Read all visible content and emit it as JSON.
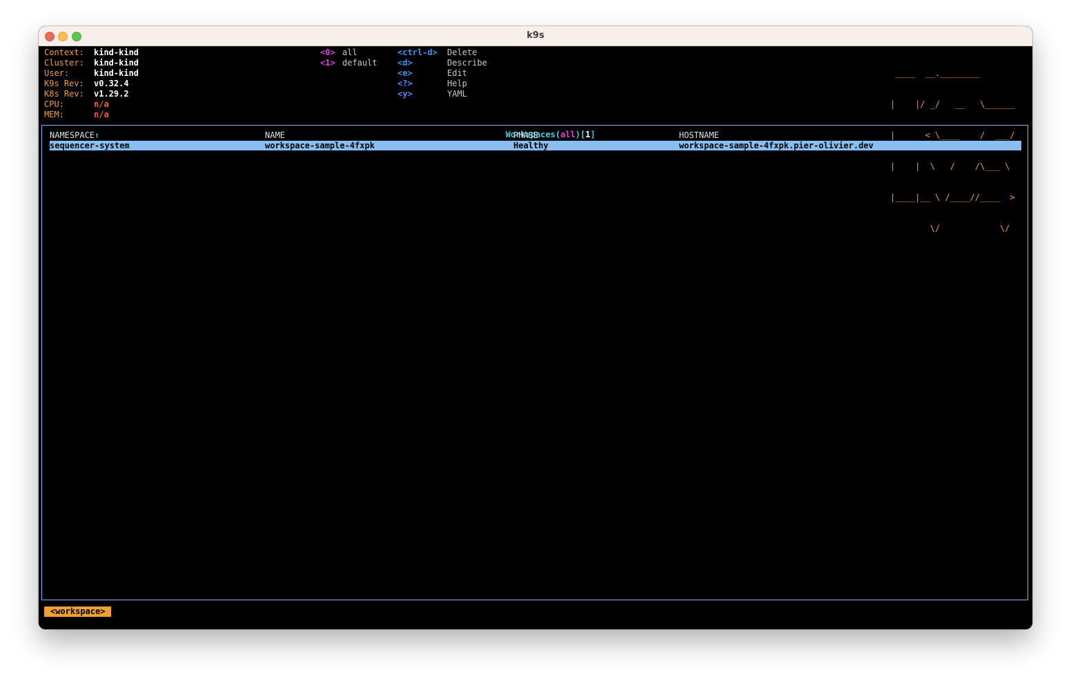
{
  "window": {
    "title": "k9s"
  },
  "info": {
    "context_label": "Context:",
    "context_value": "kind-kind",
    "cluster_label": "Cluster:",
    "cluster_value": "kind-kind",
    "user_label": "User:",
    "user_value": "kind-kind",
    "k9s_rev_label": "K9s Rev:",
    "k9s_rev_value": "v0.32.4",
    "k8s_rev_label": "K8s Rev:",
    "k8s_rev_value": "v1.29.2",
    "cpu_label": "CPU:",
    "cpu_value": "n/a",
    "mem_label": "MEM:",
    "mem_value": "n/a"
  },
  "namespaces": [
    {
      "key": "<0>",
      "label": "all"
    },
    {
      "key": "<1>",
      "label": "default"
    }
  ],
  "hotkeys": [
    {
      "key": "<ctrl-d>",
      "label": "Delete"
    },
    {
      "key": "<d>",
      "label": "Describe"
    },
    {
      "key": "<e>",
      "label": "Edit"
    },
    {
      "key": "<?>",
      "label": "Help"
    },
    {
      "key": "<y>",
      "label": "YAML"
    }
  ],
  "logo": [
    " ____  __.________       ",
    "|    |/ _/   __   \\______",
    "|      < \\____    /  ___/",
    "|    |  \\   /    /\\___ \\ ",
    "|____|__ \\ /____//____  >",
    "        \\/            \\/ "
  ],
  "table": {
    "resource": "Workspaces",
    "namespace": "all",
    "count": "1",
    "headers": {
      "namespace": "NAMESPACE",
      "sort_indicator": "↑",
      "name": "NAME",
      "phase": "PHASE",
      "hostname": "HOSTNAME"
    },
    "rows": [
      {
        "namespace": "sequencer-system",
        "name": "workspace-sample-4fxpk",
        "phase": "Healthy",
        "hostname": "workspace-sample-4fxpk.pier-olivier.dev"
      }
    ]
  },
  "breadcrumb": "<workspace>",
  "colors": {
    "label": "#f0a030",
    "namespace_key": "#e040e0",
    "hotkey": "#4a8cf0",
    "frame_border": "#8aa8ff",
    "title_resource": "#40d0e0",
    "selected_row": "#87bff2",
    "crumb_bg": "#f0a030"
  }
}
